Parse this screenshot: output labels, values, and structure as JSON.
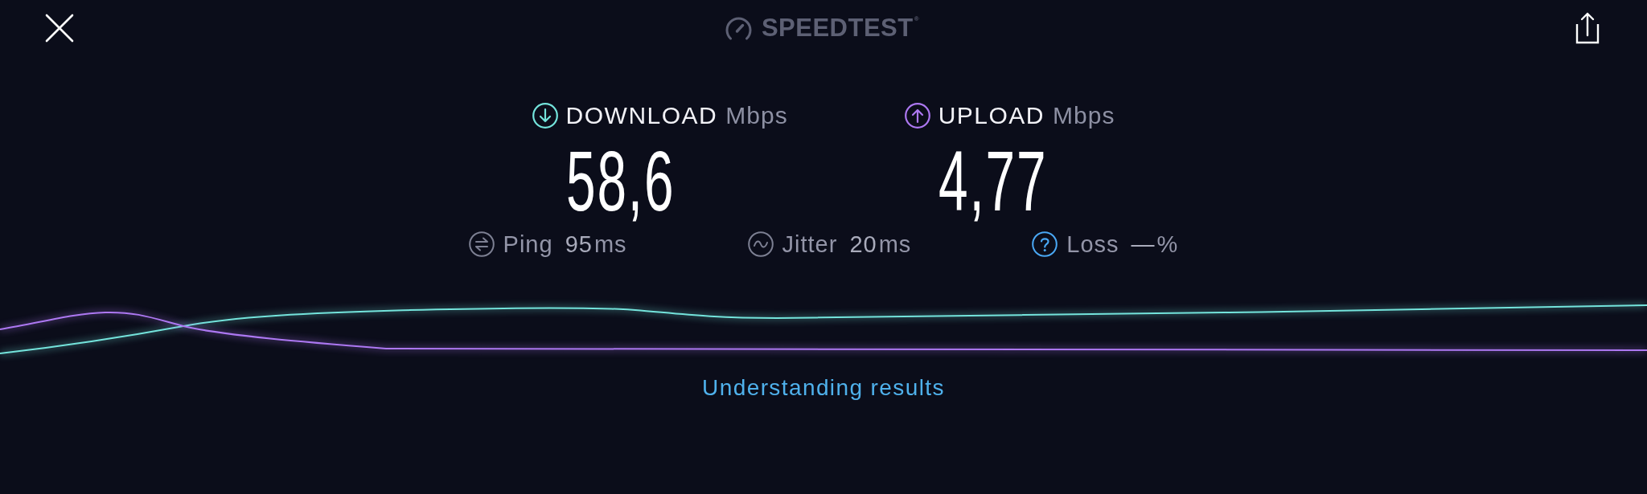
{
  "top_bar": {
    "logo": "SPEEDTEST$^{®}$"
  },
  "results": [
    {
      "kind": "download",
      "label": "DOWNLOAD",
      "unit": "Mbps",
      "value": "58,6",
      "color": "#74e4dc"
    },
    {
      "kind": "upload",
      "label": "UPLOAD",
      "unit": "Mbps",
      "value": "4,77",
      "color": "#ad78f2"
    }
  ],
  "stats": [
    {
      "kind": "ping",
      "label": "Ping",
      "value": "95",
      "unit": "ms"
    },
    {
      "kind": "jitter",
      "label": "Jitter",
      "value": "20",
      "unit": "ms"
    },
    {
      "kind": "loss",
      "label": "Loss",
      "value": "—",
      "unit": "%"
    }
  ],
  "link": "Understanding results"
}
